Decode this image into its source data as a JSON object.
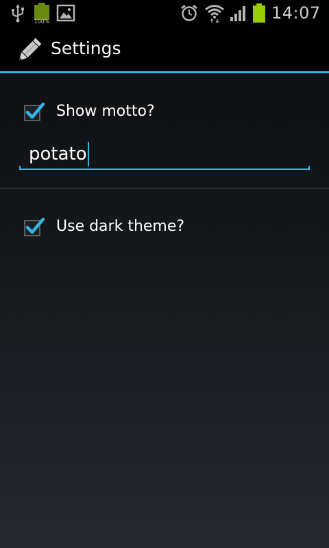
{
  "status_bar": {
    "time": "14:07",
    "battery_small_label": "100%",
    "icons": [
      "usb-icon",
      "battery-full-icon",
      "gallery-icon",
      "alarm-icon",
      "wifi-icon",
      "signal-icon",
      "battery-icon"
    ],
    "colors": {
      "battery_green": "#99cc00",
      "icon_gray": "#b5b5b5"
    }
  },
  "action_bar": {
    "title": "Settings",
    "app_icon": "pencil-icon",
    "accent": "#33b5e5"
  },
  "preferences": {
    "show_motto": {
      "label": "Show motto?",
      "checked": true
    },
    "motto_field": {
      "value": "potato"
    },
    "dark_theme": {
      "label": "Use dark theme?",
      "checked": true
    }
  }
}
